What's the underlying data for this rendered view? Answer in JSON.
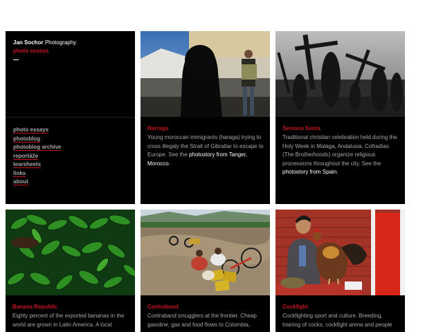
{
  "site": {
    "name_first": "Jan Sochor",
    "name_second": "Photography",
    "section": "photo essays",
    "nav": [
      "photo essays",
      "photoblog",
      "photoblog archive",
      "reportáže",
      "tearsheets",
      "links",
      "about"
    ]
  },
  "essays": [
    {
      "title": "Harraga",
      "text": "Young moroccan immigrants (haraga) trying to cross illegaly the Strait of Gibraltar to escape to Europe. See the ",
      "link": "photostory from Tanger, Morocco",
      "after": "."
    },
    {
      "title": "Semana Santa",
      "text": "Traditional christian celebration held during the Holy Week in Malaga, Andalusia. Cofradías (The Brotherhoods) organize religious processions throughout the city. See the ",
      "link": "photostory from Spain",
      "after": "."
    },
    {
      "title": "Banana Republic",
      "text": "Eighty percent of the exported bananas in the world are grown in Latin America. A local",
      "link": "",
      "after": ""
    },
    {
      "title": "Contraband",
      "text": "Contraband smugglers at the frontier. Cheap gasoline, gas and food flows to Colombia,",
      "link": "",
      "after": ""
    },
    {
      "title": "Cockfight",
      "text": "Cockfighting sport and culture. Breeding, training of cocks, cockfight arena and people",
      "link": "",
      "after": ""
    }
  ]
}
